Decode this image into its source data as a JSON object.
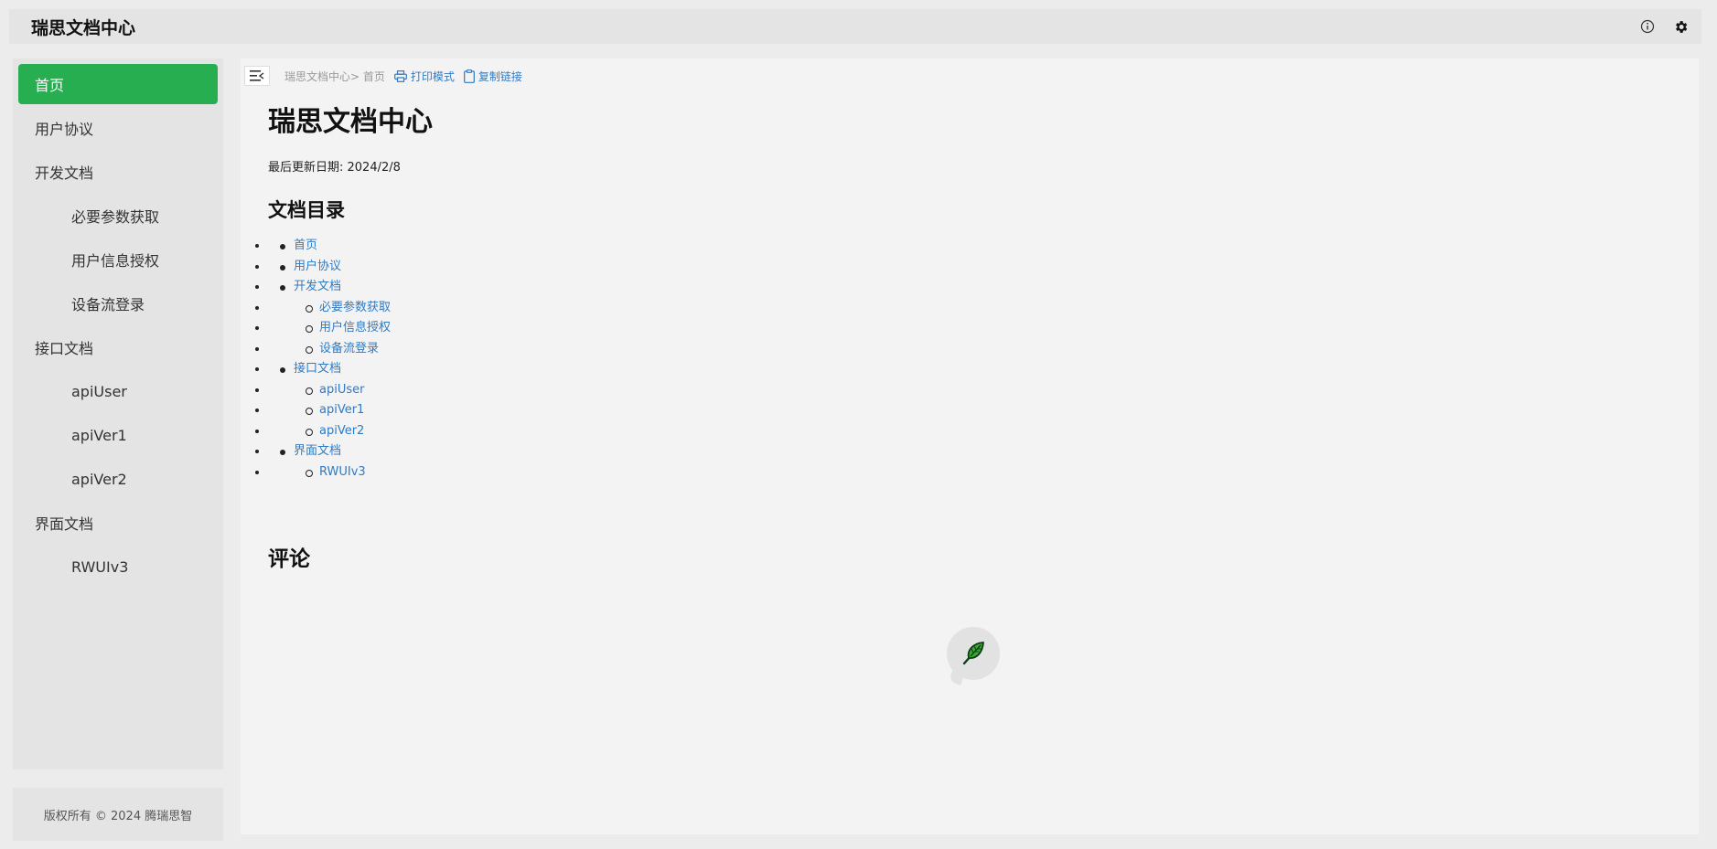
{
  "topbar": {
    "brand": "瑞思文档中心",
    "icons": [
      "info-icon",
      "gear-icon"
    ]
  },
  "sidebar": {
    "items": [
      {
        "label": "首页",
        "level": 0,
        "active": true
      },
      {
        "label": "用户协议",
        "level": 0
      },
      {
        "label": "开发文档",
        "level": 0
      },
      {
        "label": "必要参数获取",
        "level": 1
      },
      {
        "label": "用户信息授权",
        "level": 1
      },
      {
        "label": "设备流登录",
        "level": 1
      },
      {
        "label": "接口文档",
        "level": 0
      },
      {
        "label": "apiUser",
        "level": 1
      },
      {
        "label": "apiVer1",
        "level": 1
      },
      {
        "label": "apiVer2",
        "level": 1
      },
      {
        "label": "界面文档",
        "level": 0
      },
      {
        "label": "RWUIv3",
        "level": 1
      }
    ]
  },
  "footer": {
    "text": "版权所有 © 2024 腾瑞思智"
  },
  "content": {
    "breadcrumb": "瑞思文档中心> 首页",
    "print_label": "打印模式",
    "copy_label": "复制链接",
    "title": "瑞思文档中心",
    "updated_label": "最后更新日期: 2024/2/8",
    "toc_title": "文档目录",
    "toc": [
      {
        "label": "首页",
        "level": 0
      },
      {
        "label": "用户协议",
        "level": 0
      },
      {
        "label": "开发文档",
        "level": 0
      },
      {
        "label": "必要参数获取",
        "level": 1
      },
      {
        "label": "用户信息授权",
        "level": 1
      },
      {
        "label": "设备流登录",
        "level": 1
      },
      {
        "label": "接口文档",
        "level": 0
      },
      {
        "label": "apiUser",
        "level": 1
      },
      {
        "label": "apiVer1",
        "level": 1
      },
      {
        "label": "apiVer2",
        "level": 1
      },
      {
        "label": "界面文档",
        "level": 0
      },
      {
        "label": "RWUIv3",
        "level": 1
      }
    ],
    "comments_title": "评论"
  },
  "colors": {
    "accent": "#27ae50",
    "link": "#2f7bc4",
    "panel": "#e4e4e4",
    "content_bg": "#f3f3f3"
  }
}
